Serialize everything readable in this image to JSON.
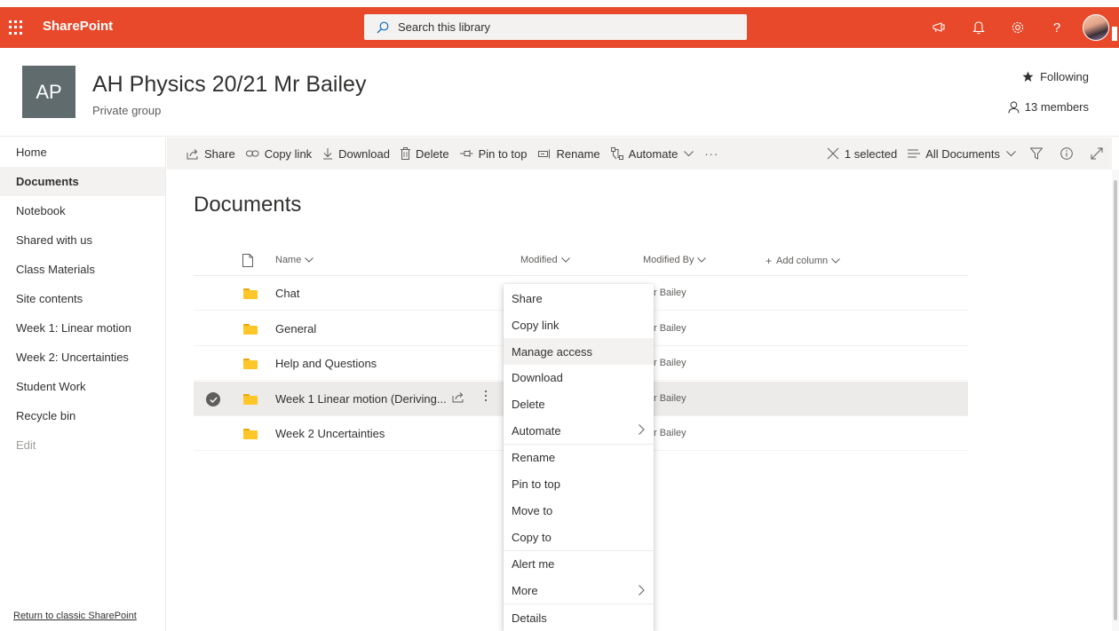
{
  "suitebar": {
    "app_name": "SharePoint",
    "search_placeholder": "Search this library",
    "icons": [
      "waffle-icon",
      "search-icon",
      "megaphone-icon",
      "bell-icon",
      "gear-icon",
      "help-icon",
      "avatar"
    ],
    "help_glyph": "?"
  },
  "site": {
    "logo_text": "AP",
    "title": "AH Physics 20/21 Mr Bailey",
    "subtitle": "Private group",
    "following_label": "Following",
    "members_label": "13 members"
  },
  "nav": {
    "items": [
      {
        "label": "Home",
        "active": false
      },
      {
        "label": "Documents",
        "active": true
      },
      {
        "label": "Notebook",
        "active": false
      },
      {
        "label": "Shared with us",
        "active": false
      },
      {
        "label": "Class Materials",
        "active": false
      },
      {
        "label": "Site contents",
        "active": false
      },
      {
        "label": "Week 1: Linear motion",
        "active": false
      },
      {
        "label": "Week 2: Uncertainties",
        "active": false
      },
      {
        "label": "Student Work",
        "active": false
      },
      {
        "label": "Recycle bin",
        "active": false
      }
    ],
    "edit_label": "Edit",
    "return_link": "Return to classic SharePoint"
  },
  "commandbar": {
    "share": "Share",
    "copy_link": "Copy link",
    "download": "Download",
    "delete": "Delete",
    "pin_to_top": "Pin to top",
    "rename": "Rename",
    "automate": "Automate",
    "overflow": "···",
    "selected_count": "1 selected",
    "view_name": "All Documents"
  },
  "main": {
    "title": "Documents",
    "columns": {
      "name": "Name",
      "modified": "Modified",
      "modified_by": "Modified By",
      "add_column": "Add column"
    },
    "rows": [
      {
        "name": "Chat",
        "modified_by": "r Bailey",
        "selected": false
      },
      {
        "name": "General",
        "modified_by": "r Bailey",
        "selected": false
      },
      {
        "name": "Help and Questions",
        "modified_by": "r Bailey",
        "selected": false
      },
      {
        "name": "Week 1 Linear motion (Deriving...",
        "modified_by": "r Bailey",
        "selected": true
      },
      {
        "name": "Week 2 Uncertainties",
        "modified_by": "r Bailey",
        "selected": false
      }
    ]
  },
  "context_menu": {
    "items": [
      {
        "label": "Share",
        "submenu": false
      },
      {
        "label": "Copy link",
        "submenu": false
      },
      {
        "label": "Manage access",
        "submenu": false,
        "hover": true
      },
      {
        "label": "Download",
        "submenu": false
      },
      {
        "label": "Delete",
        "submenu": false
      },
      {
        "label": "Automate",
        "submenu": true
      },
      {
        "label": "Rename",
        "submenu": false
      },
      {
        "label": "Pin to top",
        "submenu": false
      },
      {
        "label": "Move to",
        "submenu": false
      },
      {
        "label": "Copy to",
        "submenu": false
      },
      {
        "label": "Alert me",
        "submenu": false
      },
      {
        "label": "More",
        "submenu": true
      },
      {
        "label": "Details",
        "submenu": false
      }
    ]
  },
  "colors": {
    "suitebar": "#e8492a",
    "logo_bg": "#5f6b6d",
    "folder": "#ffc62a",
    "selected_row": "#edebe9"
  }
}
